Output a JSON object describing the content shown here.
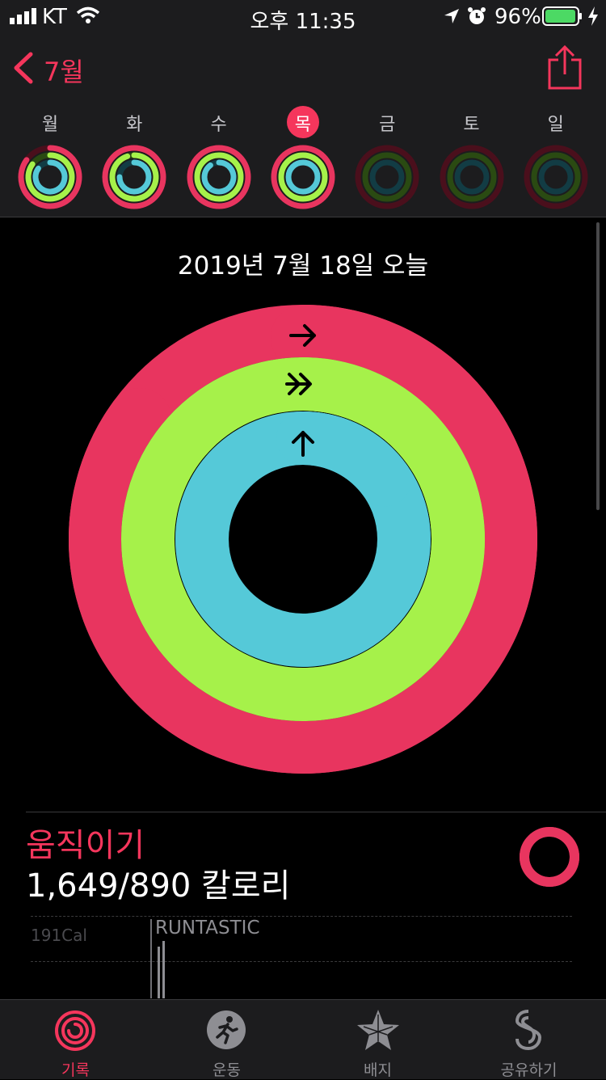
{
  "status_bar": {
    "carrier": "KT",
    "time": "오후 11:35",
    "battery_percent": "96%"
  },
  "nav": {
    "back_label": "7월",
    "share_icon": "share-icon",
    "back_icon": "chevron-left-icon"
  },
  "week": {
    "days": [
      {
        "label": "월",
        "today": false,
        "move": 0.85,
        "exercise": 0.85,
        "stand": 0.85
      },
      {
        "label": "화",
        "today": false,
        "move": 1.0,
        "exercise": 0.95,
        "stand": 0.75
      },
      {
        "label": "수",
        "today": false,
        "move": 1.0,
        "exercise": 1.0,
        "stand": 0.9
      },
      {
        "label": "목",
        "today": true,
        "move": 1.0,
        "exercise": 1.0,
        "stand": 1.0
      },
      {
        "label": "금",
        "today": false,
        "move": 0,
        "exercise": 0,
        "stand": 0
      },
      {
        "label": "토",
        "today": false,
        "move": 0,
        "exercise": 0,
        "stand": 0
      },
      {
        "label": "일",
        "today": false,
        "move": 0,
        "exercise": 0,
        "stand": 0
      }
    ]
  },
  "summary": {
    "date_title": "2019년 7월 18일 오늘",
    "move_progress": 1.85,
    "exercise_progress": 1.3,
    "stand_progress": 1.15
  },
  "move_section": {
    "title": "움직이기",
    "value": "1,649/890 칼로리",
    "chart_axis_label": "191Cal",
    "chart_annotation": "RUNTASTIC"
  },
  "tabs": [
    {
      "label": "기록",
      "icon": "activity-rings-icon",
      "active": true
    },
    {
      "label": "운동",
      "icon": "running-figure-icon",
      "active": false
    },
    {
      "label": "배지",
      "icon": "badge-star-icon",
      "active": false
    },
    {
      "label": "공유하기",
      "icon": "sharing-icon",
      "active": false
    }
  ],
  "colors": {
    "move": "#e8355f",
    "move_dark": "#4a0f1c",
    "exercise": "#a6f14a",
    "exercise_dark": "#2a4a12",
    "stand": "#55c9d8",
    "stand_dark": "#123c44",
    "accent": "#f5365c"
  }
}
